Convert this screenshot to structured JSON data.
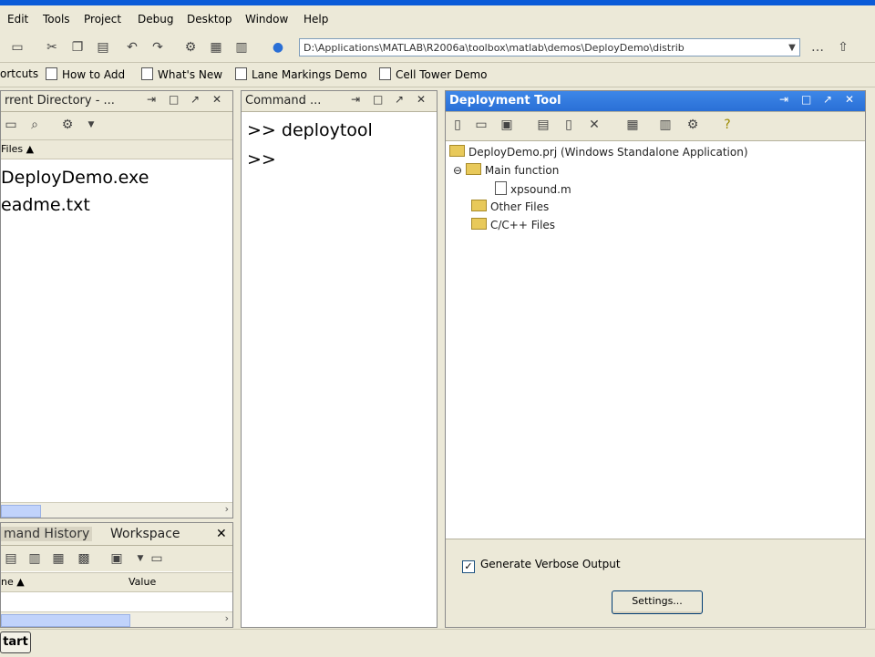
{
  "menu": [
    "Edit",
    "Tools",
    "Project",
    "Debug",
    "Desktop",
    "Window",
    "Help"
  ],
  "path": "D:\\Applications\\MATLAB\\R2006a\\toolbox\\matlab\\demos\\DeployDemo\\distrib",
  "shortcuts": [
    "ortcuts",
    "How to Add",
    "What's New",
    "Lane Markings Demo",
    "Cell Tower Demo"
  ],
  "current_directory": {
    "title": "rrent Directory - ...",
    "column_header": "Files",
    "files": [
      "DeployDemo.exe",
      "eadme.txt"
    ]
  },
  "history": {
    "tab1": "mand History",
    "tab2": "Workspace",
    "col_name": "ne",
    "col_value": "Value"
  },
  "command": {
    "title": "Command ...",
    "lines": [
      ">> deploytool",
      ">>"
    ]
  },
  "deployment": {
    "title": "Deployment Tool",
    "project": "DeployDemo.prj (Windows Standalone Application)",
    "main_function": "Main function",
    "main_file": "xpsound.m",
    "other_files": "Other Files",
    "cpp_files": "C/C++ Files",
    "verbose_label": "Generate Verbose Output",
    "verbose_checked": "✓",
    "settings_button": "Settings..."
  },
  "taskbar": {
    "start": "tart"
  },
  "colors": {
    "titlebar": "#2a6fd6",
    "chrome": "#ece9d8"
  }
}
